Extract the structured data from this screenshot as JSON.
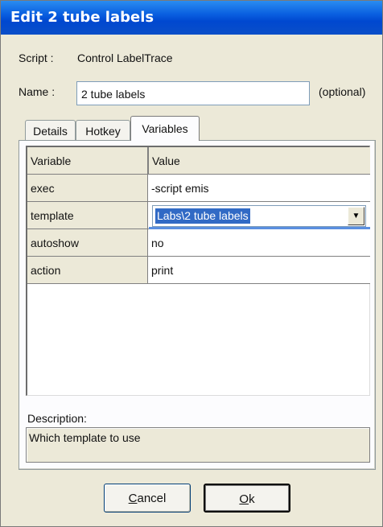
{
  "window": {
    "title": "Edit 2 tube labels"
  },
  "script": {
    "label": "Script :",
    "value": "Control LabelTrace"
  },
  "name": {
    "label": "Name :",
    "value": "2 tube labels",
    "hint": "(optional)"
  },
  "tabs": [
    {
      "label": "Details",
      "active": false
    },
    {
      "label": "Hotkey",
      "active": false
    },
    {
      "label": "Variables",
      "active": true
    }
  ],
  "grid": {
    "headers": [
      "Variable",
      "Value"
    ],
    "rows": [
      {
        "variable": "exec",
        "value": "-script emis"
      },
      {
        "variable": "template",
        "value": "Labs\\2 tube labels",
        "editor": "combobox"
      },
      {
        "variable": "autoshow",
        "value": "no"
      },
      {
        "variable": "action",
        "value": "print"
      }
    ]
  },
  "description": {
    "label": "Description:",
    "text": "Which template to use"
  },
  "buttons": {
    "cancel": {
      "accel": "C",
      "rest": "ancel"
    },
    "ok": {
      "accel": "O",
      "rest": "k"
    }
  },
  "colors": {
    "titlebar": "#0a5fe0",
    "dialog_bg": "#ece9d8",
    "selection": "#316ac5"
  }
}
